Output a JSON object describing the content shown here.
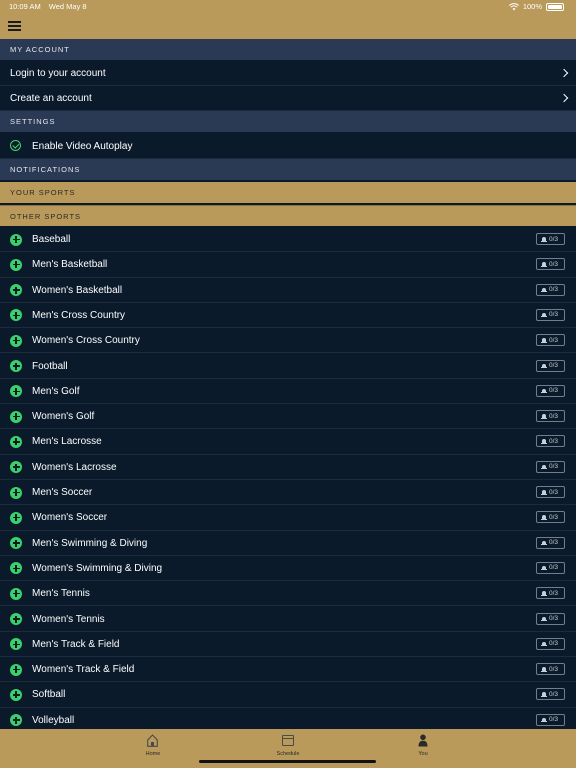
{
  "status_bar": {
    "time": "10:09 AM",
    "date": "Wed May 8",
    "battery": "100%"
  },
  "sections": {
    "my_account": "MY ACCOUNT",
    "settings": "SETTINGS",
    "notifications": "NOTIFICATIONS",
    "your_sports": "YOUR SPORTS",
    "other_sports": "OTHER SPORTS"
  },
  "account": {
    "login": "Login to your account",
    "create": "Create an account"
  },
  "settings": {
    "autoplay": "Enable Video Autoplay"
  },
  "sports": [
    {
      "name": "Baseball",
      "alerts": "0/3"
    },
    {
      "name": "Men's Basketball",
      "alerts": "0/3"
    },
    {
      "name": "Women's Basketball",
      "alerts": "0/3"
    },
    {
      "name": "Men's Cross Country",
      "alerts": "0/3"
    },
    {
      "name": "Women's Cross Country",
      "alerts": "0/3"
    },
    {
      "name": "Football",
      "alerts": "0/3"
    },
    {
      "name": "Men's Golf",
      "alerts": "0/3"
    },
    {
      "name": "Women's Golf",
      "alerts": "0/3"
    },
    {
      "name": "Men's Lacrosse",
      "alerts": "0/3"
    },
    {
      "name": "Women's Lacrosse",
      "alerts": "0/3"
    },
    {
      "name": "Men's Soccer",
      "alerts": "0/3"
    },
    {
      "name": "Women's Soccer",
      "alerts": "0/3"
    },
    {
      "name": "Men's Swimming & Diving",
      "alerts": "0/3"
    },
    {
      "name": "Women's Swimming & Diving",
      "alerts": "0/3"
    },
    {
      "name": "Men's Tennis",
      "alerts": "0/3"
    },
    {
      "name": "Women's Tennis",
      "alerts": "0/3"
    },
    {
      "name": "Men's Track & Field",
      "alerts": "0/3"
    },
    {
      "name": "Women's Track & Field",
      "alerts": "0/3"
    },
    {
      "name": "Softball",
      "alerts": "0/3"
    },
    {
      "name": "Volleyball",
      "alerts": "0/3"
    }
  ],
  "tabs": {
    "home": "Home",
    "schedule": "Schedule",
    "you": "You"
  },
  "colors": {
    "gold": "#b99a5b",
    "navy": "#0a1a2a",
    "section": "#2a3a54",
    "accent_green": "#3ad06a"
  }
}
